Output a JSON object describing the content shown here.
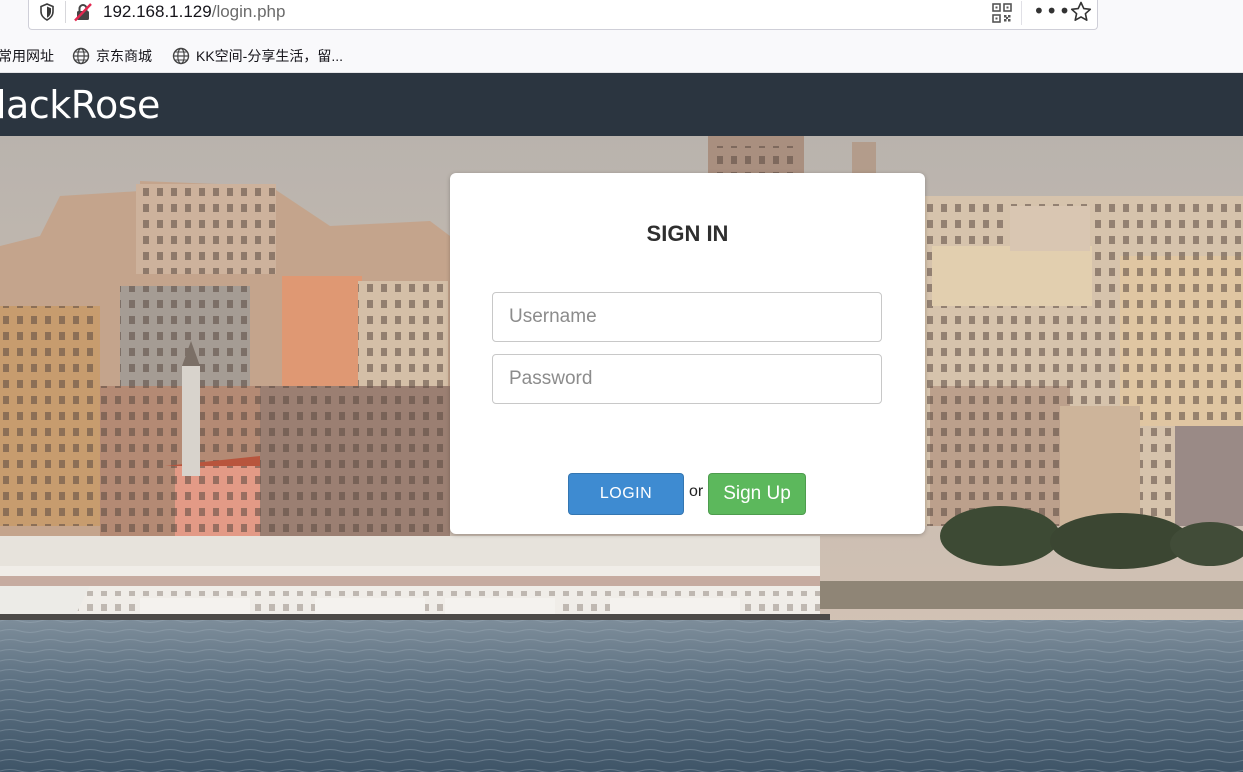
{
  "browser": {
    "url_host": "192.168.1.129",
    "url_path": "/login.php",
    "bookmarks": [
      {
        "label": "常用网址",
        "icon": "none"
      },
      {
        "label": "京东商城",
        "icon": "globe-icon"
      },
      {
        "label": "KK空间-分享生活，留...",
        "icon": "globe-icon"
      }
    ]
  },
  "navbar": {
    "brand": "lackRose"
  },
  "login": {
    "title": "SIGN IN",
    "username_placeholder": "Username",
    "password_placeholder": "Password",
    "login_label": "LOGIN",
    "or_label": "or",
    "signup_label": "Sign Up"
  },
  "colors": {
    "navbar_bg": "#2b3540",
    "login_button": "#3e8bd1",
    "signup_button": "#5cb85c",
    "card_bg": "#ffffff"
  }
}
